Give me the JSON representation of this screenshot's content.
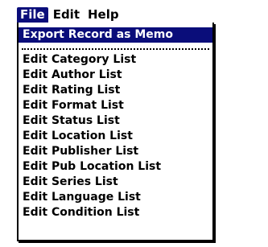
{
  "menubar": {
    "tabs": [
      {
        "label": "File"
      },
      {
        "label": "Edit"
      },
      {
        "label": "Help"
      }
    ]
  },
  "menu": {
    "highlighted": {
      "label": "Export Record as Memo"
    },
    "items": [
      {
        "label": "Edit Category List"
      },
      {
        "label": "Edit Author List"
      },
      {
        "label": "Edit Rating List"
      },
      {
        "label": "Edit Format List"
      },
      {
        "label": "Edit Status List"
      },
      {
        "label": "Edit Location List"
      },
      {
        "label": "Edit Publisher List"
      },
      {
        "label": "Edit Pub Location List"
      },
      {
        "label": "Edit Series List"
      },
      {
        "label": "Edit Language List"
      },
      {
        "label": "Edit Condition List"
      }
    ]
  },
  "colors": {
    "highlight": "#0a0d7a",
    "text": "#000000",
    "background": "#ffffff"
  }
}
